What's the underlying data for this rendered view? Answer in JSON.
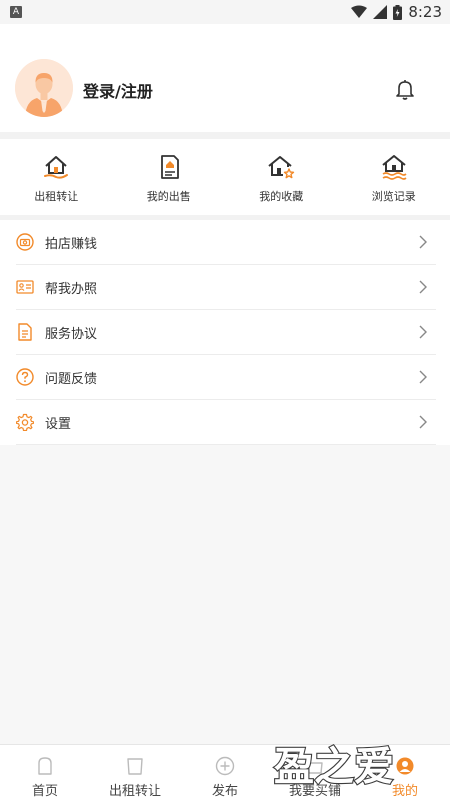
{
  "status_bar": {
    "app_icon_letter": "A",
    "time": "8:23"
  },
  "header": {
    "login_label": "登录/注册"
  },
  "quick_actions": [
    {
      "label": "出租转让",
      "icon": "house-hand-icon"
    },
    {
      "label": "我的出售",
      "icon": "document-house-icon"
    },
    {
      "label": "我的收藏",
      "icon": "house-star-icon"
    },
    {
      "label": "浏览记录",
      "icon": "house-waves-icon"
    }
  ],
  "menu_items": [
    {
      "label": "拍店赚钱",
      "icon": "camera-circle-icon"
    },
    {
      "label": "帮我办照",
      "icon": "id-card-icon"
    },
    {
      "label": "服务协议",
      "icon": "document-icon"
    },
    {
      "label": "问题反馈",
      "icon": "question-icon"
    },
    {
      "label": "设置",
      "icon": "gear-icon"
    }
  ],
  "tabbar": [
    {
      "label": "首页",
      "icon": "home-icon",
      "active": false
    },
    {
      "label": "出租转让",
      "icon": "transfer-icon",
      "active": false
    },
    {
      "label": "发布",
      "icon": "plus-circle-icon",
      "active": false
    },
    {
      "label": "我要买铺",
      "icon": "shop-icon",
      "active": false
    },
    {
      "label": "我的",
      "icon": "user-icon",
      "active": true
    }
  ],
  "watermark": {
    "text": "盈之爱"
  },
  "colors": {
    "accent": "#f28a2a",
    "icon_dark": "#333333"
  }
}
